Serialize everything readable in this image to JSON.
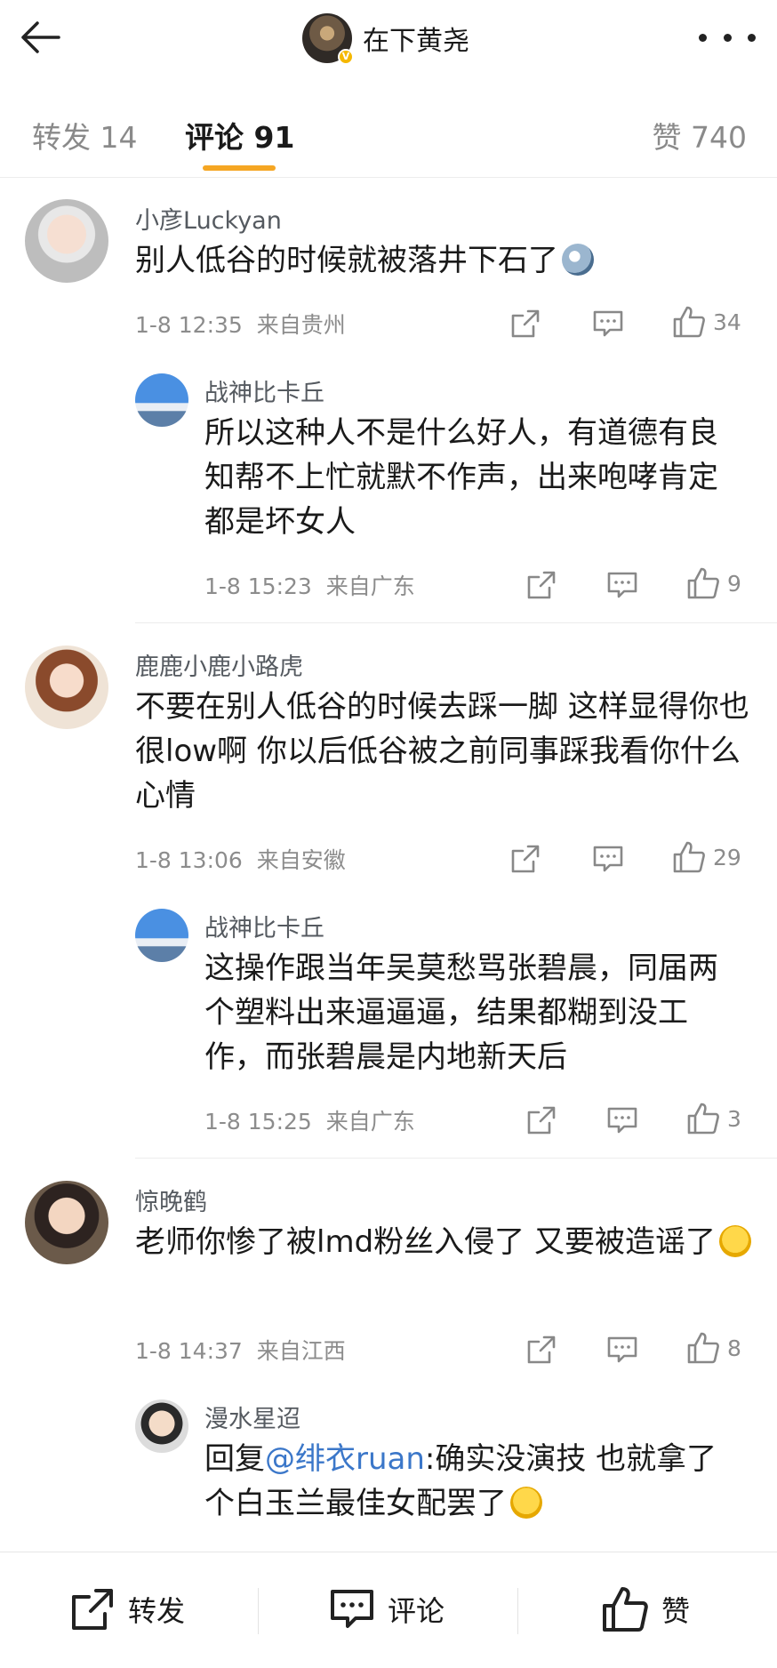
{
  "header": {
    "title": "在下黄尧",
    "back_icon": "back-arrow-icon",
    "more_icon": "more-dots-icon",
    "verified_badge": "V"
  },
  "tabs": {
    "repost": "转发 14",
    "comments": "评论 91",
    "likes": "赞 740",
    "accent_color": "#f5a623"
  },
  "comments": [
    {
      "user": "小彦Luckyan",
      "text": "别人低谷的时候就被落井下石了",
      "emoji": "crazy-face-emoji",
      "time": "1-8 12:35",
      "location": "来自贵州",
      "likes": "34",
      "reply": {
        "user": "战神比卡丘",
        "text": "所以这种人不是什么好人，有道德有良知帮不上忙就默不作声，出来咆哮肯定都是坏女人",
        "time": "1-8 15:23",
        "location": "来自广东",
        "likes": "9"
      }
    },
    {
      "user": "鹿鹿小鹿小路虎",
      "text": "不要在别人低谷的时候去踩一脚 这样显得你也很low啊 你以后低谷被之前同事踩我看你什么心情",
      "time": "1-8 13:06",
      "location": "来自安徽",
      "likes": "29",
      "reply": {
        "user": "战神比卡丘",
        "text": "这操作跟当年吴莫愁骂张碧晨，同届两个塑料出来逼逼逼，结果都糊到没工作，而张碧晨是内地新天后",
        "time": "1-8 15:25",
        "location": "来自广东",
        "likes": "3"
      }
    },
    {
      "user": "惊晚鹤",
      "text": "老师你惨了被lmd粉丝入侵了 又要被造谣了",
      "emoji": "smirk-face-emoji",
      "time": "1-8 14:37",
      "location": "来自江西",
      "likes": "8",
      "reply": {
        "user": "漫水星迢",
        "text_prefix": "回复",
        "mention": "@绯衣ruan",
        "text": ":确实没演技 也就拿了个白玉兰最佳女配罢了",
        "emoji": "heart-eyes-emoji"
      }
    }
  ],
  "bottom_bar": {
    "repost": "转发",
    "comment": "评论",
    "like": "赞"
  }
}
